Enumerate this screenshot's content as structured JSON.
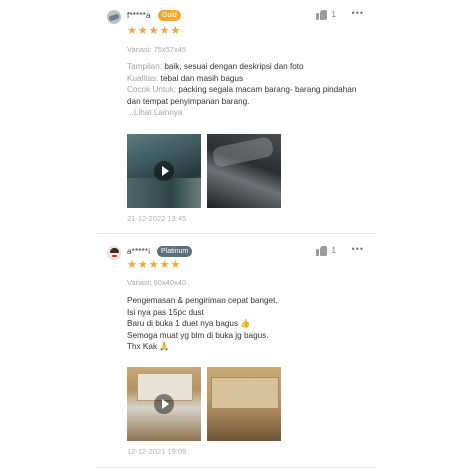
{
  "reviews": [
    {
      "username": "f*****a",
      "badge": "Gold",
      "likes": "1",
      "rating": 5,
      "stars": [
        "★",
        "★",
        "★",
        "★",
        "★"
      ],
      "variant": "Variasi: 75x57x45",
      "lines": [
        {
          "key": "Tampilan:",
          "value": " baik, sesuai dengan deskripsi dan foto"
        },
        {
          "key": "Kualitas:",
          "value": " tebal dan masih bagus"
        },
        {
          "key": "Cocok Untuk:",
          "value": " packing segala macam barang- barang pindahan dan tempat penyimpanan barang."
        }
      ],
      "see_more": "...Lihat Lainnya",
      "date": "21-12-2022 13:45"
    },
    {
      "username": "a*****i",
      "badge": "Platinum",
      "likes": "1",
      "rating": 5,
      "stars": [
        "★",
        "★",
        "★",
        "★",
        "★"
      ],
      "variant": "Variasi: 60x40x40",
      "text_lines": [
        "Pengemasan & pengiriman cepat banget.",
        "Isi nya pas 15pc dust",
        "Baru di buka 1 duet nya bagus 👍",
        "Semoga muat yg blm di buka jg bagus.",
        "Thx Kak 🙏"
      ],
      "date": "12-12-2021 19:09"
    }
  ],
  "more_label": "•••",
  "colors": {
    "star": "#f6a623",
    "gold_badge": "#f0a830",
    "platinum_badge": "#5c6f80"
  }
}
